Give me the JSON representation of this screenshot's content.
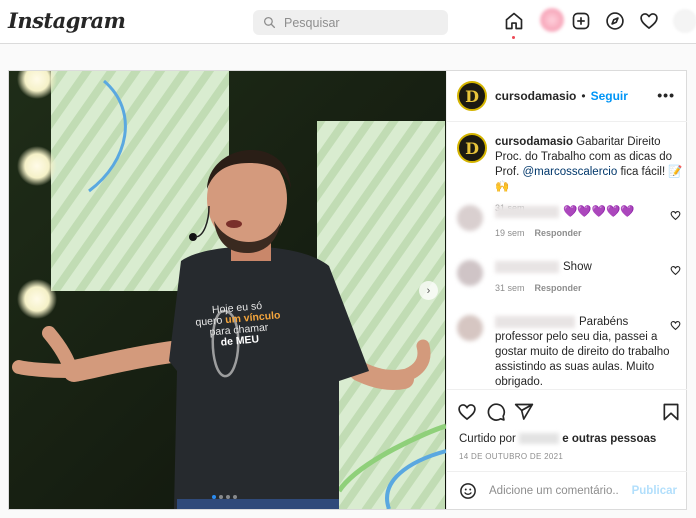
{
  "topbar": {
    "logo": "Instagram",
    "search_placeholder": "Pesquisar",
    "icons": [
      "home-icon",
      "avatar",
      "new-post-icon",
      "explore-icon",
      "activity-heart-icon",
      "profile-avatar"
    ]
  },
  "post": {
    "author": "cursodamasio",
    "separator": "•",
    "follow_label": "Seguir",
    "more_label": "•••",
    "shirt_text": {
      "line1": "Hoje eu só",
      "line2a": "quero",
      "line2b": "um vínculo",
      "line3": "para chamar",
      "line4": "de MEU"
    },
    "caption": {
      "username": "cursodamasio",
      "text": " Gabaritar Direito Proc. do Trabalho com as dicas do Prof. ",
      "mention": "@marcosscalercio",
      "text_end": " fica fácil! 📝🙌",
      "time": "31 sem"
    },
    "comments": [
      {
        "text": "💜💜💜💜💜",
        "time": "19 sem",
        "reply": "Responder"
      },
      {
        "text": "Show",
        "time": "31 sem",
        "reply": "Responder"
      },
      {
        "text": "Parabéns professor pelo seu dia, passei a gostar muito de direito do trabalho assistindo as suas aulas. Muito obrigado.",
        "time": "",
        "reply": ""
      }
    ],
    "likes": {
      "prefix": "Curtido por",
      "suffix": "e outras pessoas"
    },
    "date": "14 DE OUTUBRO DE 2021",
    "add_comment_placeholder": "Adicione um comentário...",
    "publish_label": "Publicar",
    "carousel": {
      "count": 4,
      "active": 1,
      "next_label": "›"
    }
  },
  "colors": {
    "accent": "#0095f6",
    "mention": "#00376b",
    "publish_disabled": "#b2dffc",
    "carousel_active": "#2b8cf0"
  }
}
